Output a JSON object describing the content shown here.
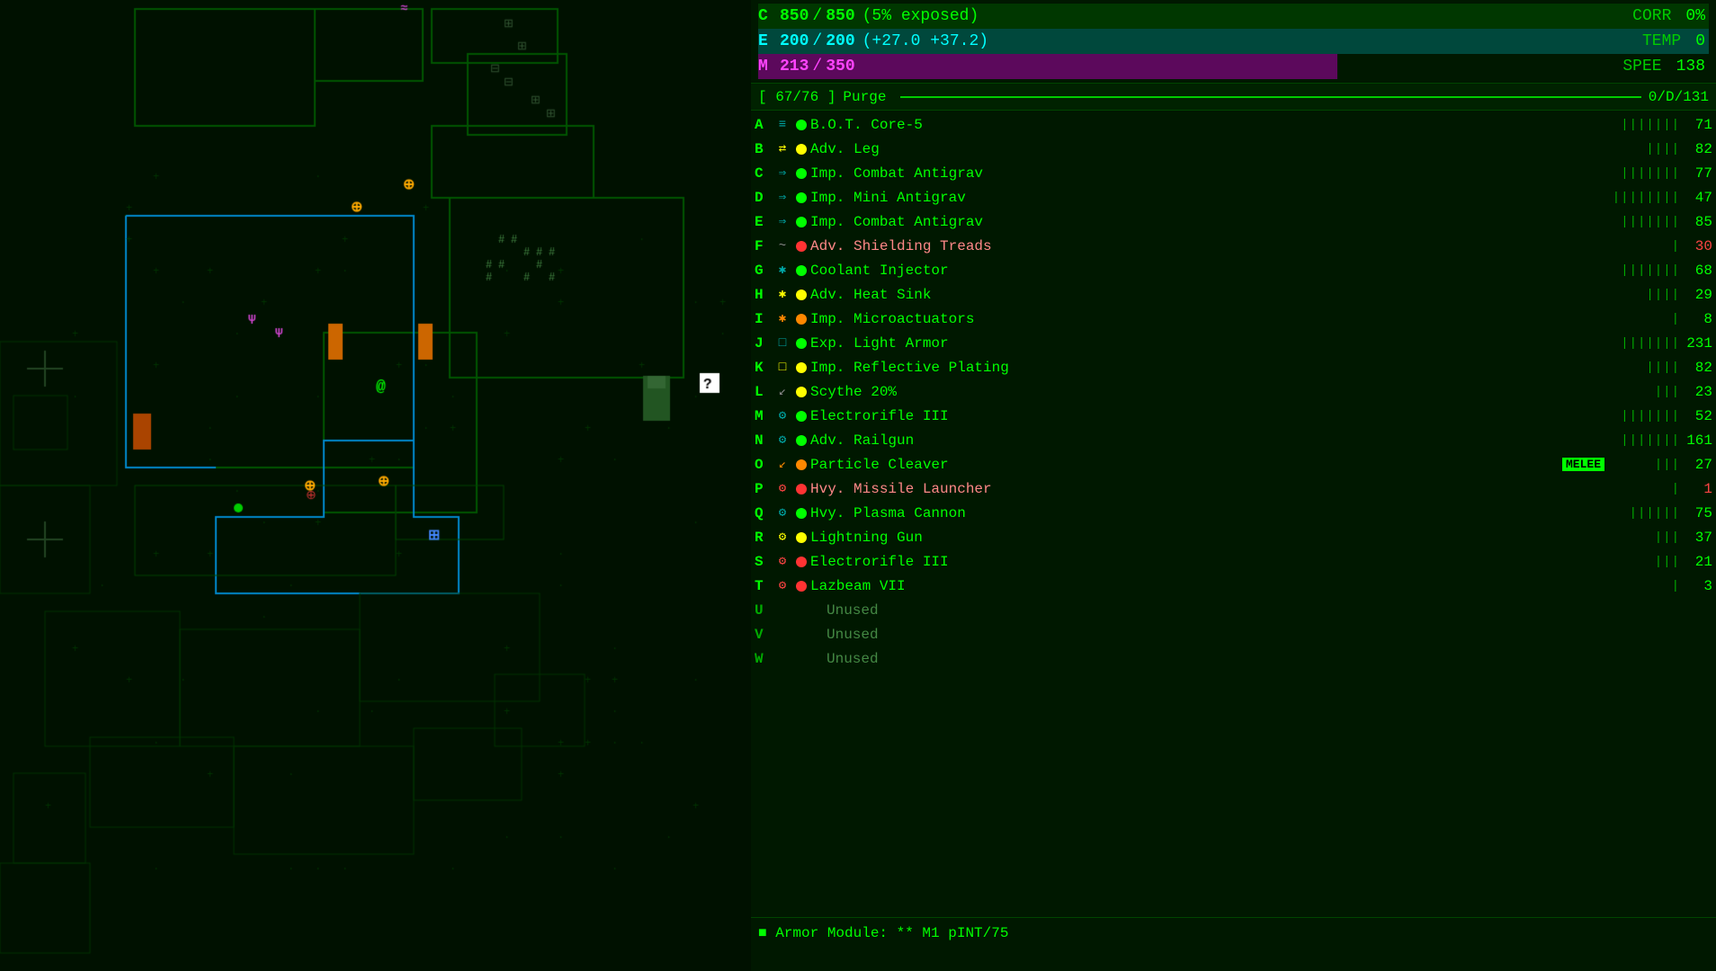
{
  "map": {
    "background_color": "#001100"
  },
  "hud": {
    "stats": {
      "integrity": {
        "label": "C",
        "current": 850,
        "max": 850,
        "note": "(5% exposed)",
        "bar_pct": 100,
        "color": "#00aa00"
      },
      "energy": {
        "label": "E",
        "current": 200,
        "max": 200,
        "bonus": "(+27.0 +37.2)",
        "bar_pct": 100,
        "color": "#00cccc"
      },
      "matter": {
        "label": "M",
        "current": 213,
        "max": 350,
        "bar_pct": 60.9,
        "color": "#aa00aa"
      }
    },
    "corr": {
      "label": "CORR",
      "value": "0%",
      "color": "#00cc00"
    },
    "temp": {
      "label": "TEMP",
      "value": "0",
      "color": "#00cc00"
    },
    "spee": {
      "label": "SPEE",
      "value": "138",
      "color": "#00ff00"
    },
    "slot_bar": {
      "left": "[ 67/76 ]",
      "center": "Purge",
      "right": "0/D/131"
    },
    "equipment": [
      {
        "key": "A",
        "icon": "≡",
        "icon_color": "#00aaaa",
        "dot": "green",
        "name": "B.O.T. Core-5",
        "slots": "|||||||",
        "integrity": "71"
      },
      {
        "key": "B",
        "icon": "⇄",
        "icon_color": "#ffff00",
        "dot": "yellow",
        "name": "Adv. Leg",
        "slots": "||||",
        "integrity": "82"
      },
      {
        "key": "C",
        "icon": "⇒",
        "icon_color": "#00aaaa",
        "dot": "green",
        "name": "Imp. Combat Antigrav",
        "slots": "|||||||",
        "integrity": "77"
      },
      {
        "key": "D",
        "icon": "⇒",
        "icon_color": "#00aaaa",
        "dot": "green",
        "name": "Imp. Mini Antigrav",
        "slots": "||||||||",
        "integrity": "47"
      },
      {
        "key": "E",
        "icon": "⇒",
        "icon_color": "#00aaaa",
        "dot": "green",
        "name": "Imp. Combat Antigrav",
        "slots": "|||||||",
        "integrity": "85"
      },
      {
        "key": "F",
        "icon": "~",
        "icon_color": "#888888",
        "dot": "red",
        "name": "Adv. Shielding Treads",
        "slots": "|",
        "integrity": "30",
        "integrity_color": "red"
      },
      {
        "key": "G",
        "icon": "✱",
        "icon_color": "#00aaaa",
        "dot": "green",
        "name": "Coolant Injector",
        "slots": "|||||||",
        "integrity": "68"
      },
      {
        "key": "H",
        "icon": "✱",
        "icon_color": "#ffff00",
        "dot": "yellow",
        "name": "Adv. Heat Sink",
        "slots": "||||",
        "integrity": "29"
      },
      {
        "key": "I",
        "icon": "✱",
        "icon_color": "#ff8800",
        "dot": "orange",
        "name": "Imp. Microactuators",
        "slots": "|",
        "integrity": "8"
      },
      {
        "key": "J",
        "icon": "□",
        "icon_color": "#00aaaa",
        "dot": "green",
        "name": "Exp. Light Armor",
        "slots": "|||||||",
        "integrity": "231"
      },
      {
        "key": "K",
        "icon": "□",
        "icon_color": "#ffff00",
        "dot": "yellow",
        "name": "Imp. Reflective Plating",
        "slots": "||||",
        "integrity": "82"
      },
      {
        "key": "L",
        "icon": "↙",
        "icon_color": "#888888",
        "dot": "yellow",
        "name": "Scythe 20%",
        "slots": "|||",
        "integrity": "23"
      },
      {
        "key": "M",
        "icon": "⚙",
        "icon_color": "#00aaaa",
        "dot": "green",
        "name": "Electrorifle III",
        "slots": "|||||||",
        "integrity": "52"
      },
      {
        "key": "N",
        "icon": "⚙",
        "icon_color": "#00aaaa",
        "dot": "green",
        "name": "Adv. Railgun",
        "slots": "|||||||",
        "integrity": "161"
      },
      {
        "key": "O",
        "icon": "↙",
        "icon_color": "#ff8800",
        "dot": "orange",
        "name": "Particle Cleaver",
        "melee": true,
        "slots": "|||",
        "integrity": "27"
      },
      {
        "key": "P",
        "icon": "⚙",
        "icon_color": "#ff4444",
        "dot": "red",
        "name": "Hvy. Missile Launcher",
        "slots": "|",
        "integrity": "1",
        "integrity_color": "red"
      },
      {
        "key": "Q",
        "icon": "⚙",
        "icon_color": "#00aaaa",
        "dot": "green",
        "name": "Hvy. Plasma Cannon",
        "slots": "||||||",
        "integrity": "75"
      },
      {
        "key": "R",
        "icon": "⚙",
        "icon_color": "#ffff00",
        "dot": "yellow",
        "name": "Lightning Gun",
        "slots": "|||",
        "integrity": "37"
      },
      {
        "key": "S",
        "icon": "⚙",
        "icon_color": "#ff4444",
        "dot": "red",
        "name": "Electrorifle III",
        "slots": "|||",
        "integrity": "21"
      },
      {
        "key": "T",
        "icon": "⚙",
        "icon_color": "#ff4444",
        "dot": "red",
        "name": "Lazbeam VII",
        "slots": "|",
        "integrity": "3"
      },
      {
        "key": "U",
        "icon": "",
        "dot": "none",
        "name": "Unused",
        "slots": "",
        "integrity": "",
        "unused": true
      },
      {
        "key": "V",
        "icon": "",
        "dot": "none",
        "name": "Unused",
        "slots": "",
        "integrity": "",
        "unused": true
      },
      {
        "key": "W",
        "icon": "",
        "dot": "none",
        "name": "Unused",
        "slots": "",
        "integrity": "",
        "unused": true
      }
    ],
    "bottom_text": "■  Armor Module: ** M1 pINT/75",
    "melee_label": "MELEE"
  }
}
